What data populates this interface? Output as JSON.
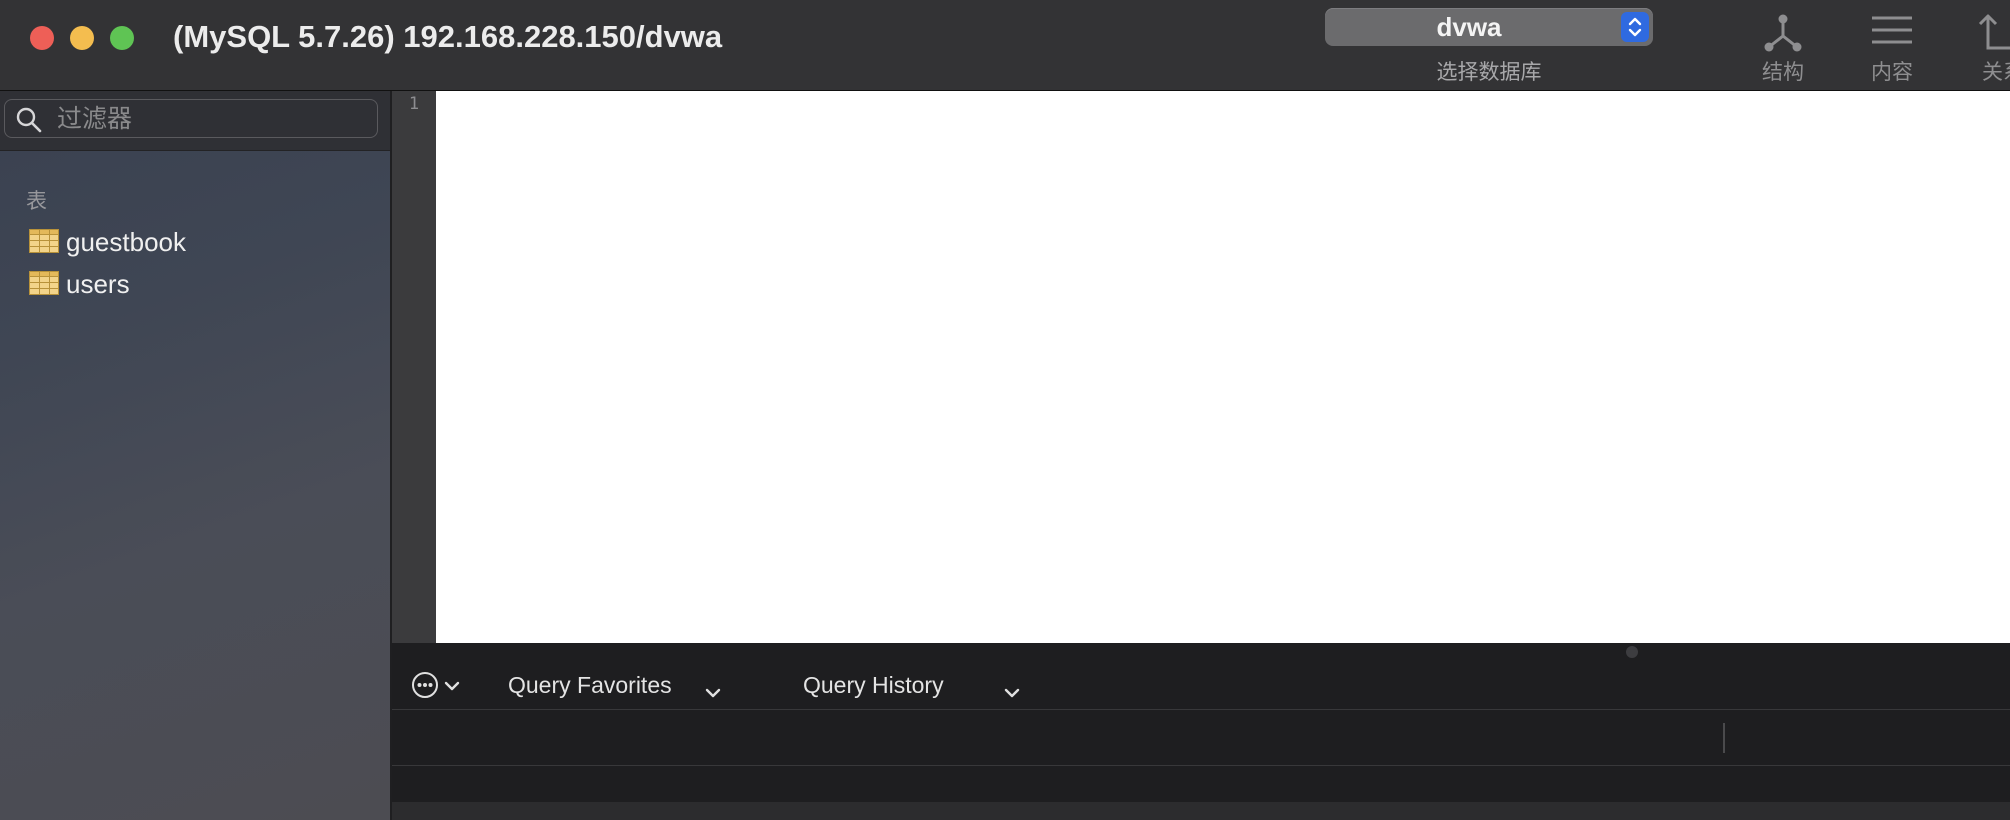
{
  "window": {
    "title": "(MySQL 5.7.26) 192.168.228.150/dvwa"
  },
  "toolbar": {
    "database_select": {
      "value": "dvwa",
      "caption": "选择数据库"
    },
    "buttons": [
      {
        "label": "结构",
        "icon": "structure-icon"
      },
      {
        "label": "内容",
        "icon": "content-icon"
      },
      {
        "label": "关系",
        "icon": "relations-icon"
      }
    ]
  },
  "sidebar": {
    "filter": {
      "placeholder": "过滤器",
      "value": ""
    },
    "section_header": "表",
    "tables": [
      {
        "name": "guestbook"
      },
      {
        "name": "users"
      }
    ]
  },
  "editor": {
    "line_numbers": [
      "1"
    ],
    "content": ""
  },
  "query_bar": {
    "favorites_label": "Query Favorites",
    "history_label": "Query History"
  },
  "colors": {
    "close": "#ee5f57",
    "minimize": "#f4bd4f",
    "maximize": "#5fc454",
    "stepper_accent": "#2f6ae0",
    "table_icon": "#f3d48a"
  }
}
